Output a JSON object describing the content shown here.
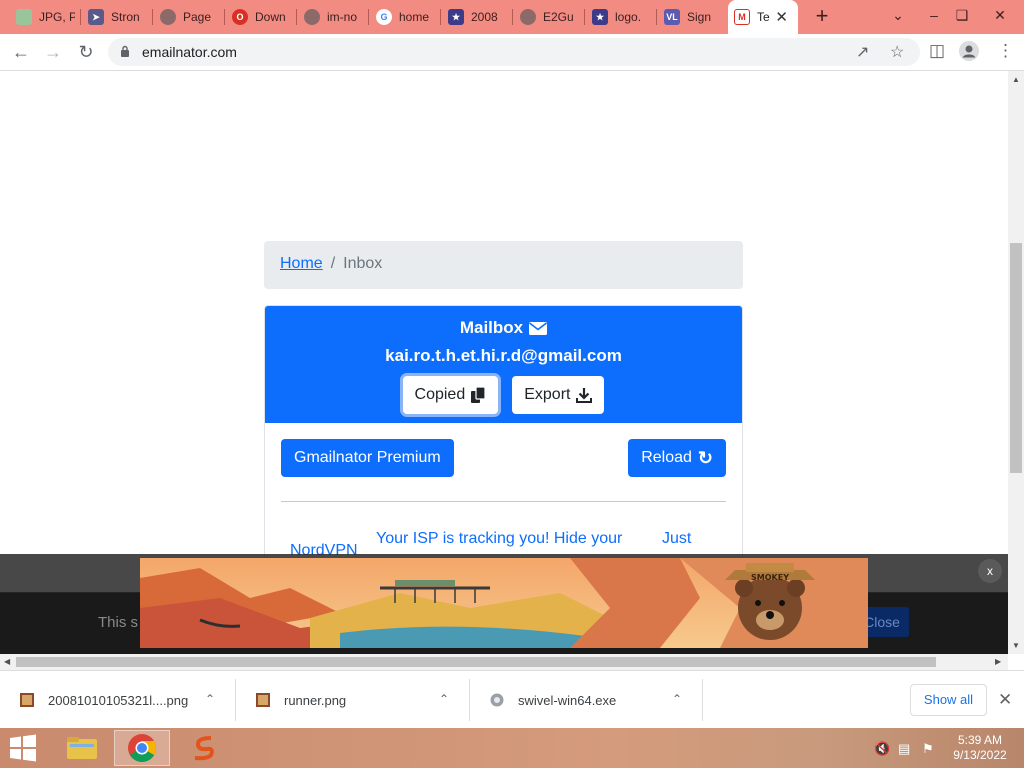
{
  "browser": {
    "tabs": [
      {
        "label": "JPG, P",
        "favicon": "ilovepdf-icon",
        "color": "#9ac59a"
      },
      {
        "label": "Stron",
        "favicon": "cursor-icon",
        "color": "#5a5a8a"
      },
      {
        "label": "Page",
        "favicon": "globe-icon",
        "color": "#8c6a6a"
      },
      {
        "label": "Down",
        "favicon": "opera-icon",
        "color": "#d93025"
      },
      {
        "label": "im-no",
        "favicon": "globe-icon",
        "color": "#8c6a6a"
      },
      {
        "label": "home",
        "favicon": "google-icon",
        "color": "#4285f4"
      },
      {
        "label": "2008",
        "favicon": "flag-icon",
        "color": "#3b3b8a"
      },
      {
        "label": "E2Gu",
        "favicon": "globe-icon",
        "color": "#8c6a6a"
      },
      {
        "label": "logo.",
        "favicon": "flag-icon",
        "color": "#3b3b8a"
      },
      {
        "label": "Sign",
        "favicon": "vl-icon",
        "color": "#5b5bb0"
      },
      {
        "label": "Te",
        "favicon": "gmail-icon",
        "color": "#d93025",
        "active": true
      }
    ],
    "new_tab": "+",
    "url": "emailnator.com"
  },
  "page": {
    "breadcrumb": {
      "home": "Home",
      "separator": "/",
      "current": "Inbox"
    },
    "mailbox": {
      "title": "Mailbox",
      "email": "kai.ro.t.h.et.hi.r.d@gmail.com",
      "copied_label": "Copied",
      "export_label": "Export"
    },
    "premium_label": "Gmailnator Premium",
    "reload_label": "Reload",
    "ad_row": {
      "sender": "NordVPN",
      "subject": "Your ISP is tracking you! Hide your",
      "time": "Just"
    },
    "consent": {
      "text": "This s",
      "close_label": "Close"
    },
    "ad_close": "x",
    "ad_banner": {
      "badge": "SMOKEY"
    }
  },
  "downloads": {
    "items": [
      {
        "name": "20081010105321l....png",
        "icon": "image-file-icon"
      },
      {
        "name": "runner.png",
        "icon": "image-file-icon"
      },
      {
        "name": "swivel-win64.exe",
        "icon": "exe-file-icon"
      }
    ],
    "show_all": "Show all"
  },
  "taskbar": {
    "time": "5:39 AM",
    "date": "9/13/2022"
  }
}
